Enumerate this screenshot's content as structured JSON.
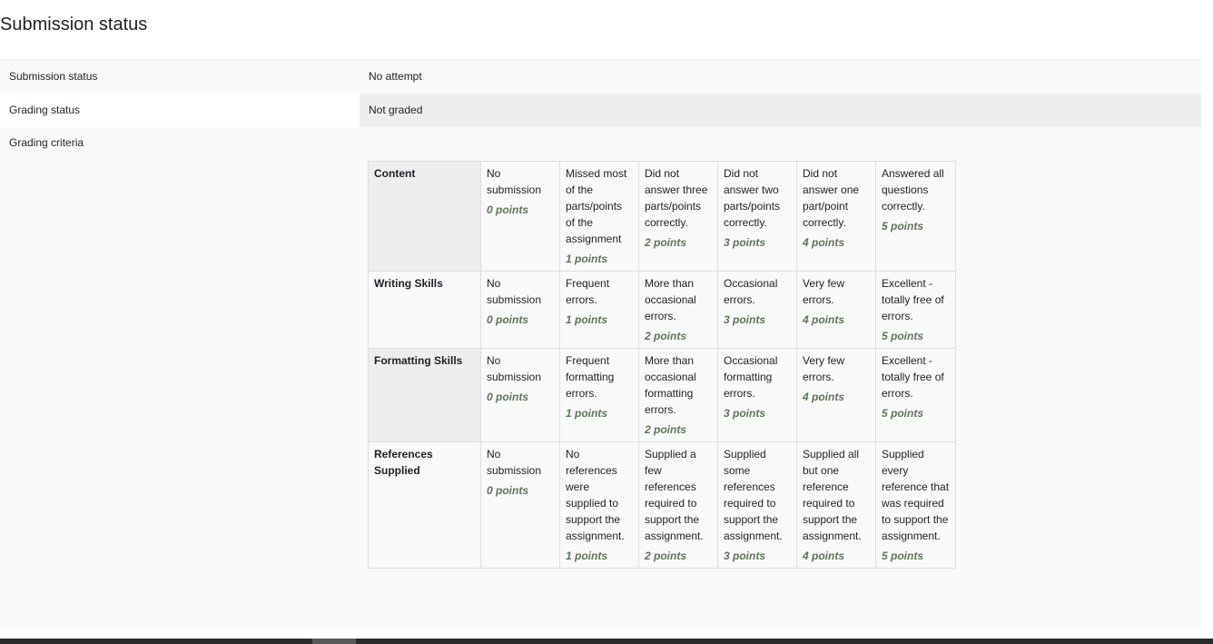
{
  "page": {
    "title": "Submission status"
  },
  "status": {
    "submission_label": "Submission status",
    "submission_value": "No attempt",
    "grading_label": "Grading status",
    "grading_value": "Not graded",
    "criteria_label": "Grading criteria"
  },
  "rubric": {
    "criteria": [
      {
        "name": "Content",
        "levels": [
          {
            "text": "No submission",
            "points": "0 points"
          },
          {
            "text": "Missed most of the parts/points of the assignment",
            "points": "1 points"
          },
          {
            "text": "Did not answer three parts/points correctly.",
            "points": "2 points"
          },
          {
            "text": "Did not answer two parts/points correctly.",
            "points": "3 points"
          },
          {
            "text": "Did not answer one part/point correctly.",
            "points": "4 points"
          },
          {
            "text": "Answered all questions correctly.",
            "points": "5 points"
          }
        ]
      },
      {
        "name": "Writing Skills",
        "levels": [
          {
            "text": "No submission",
            "points": "0 points"
          },
          {
            "text": "Frequent errors.",
            "points": "1 points"
          },
          {
            "text": "More than occasional errors.",
            "points": "2 points"
          },
          {
            "text": "Occasional errors.",
            "points": "3 points"
          },
          {
            "text": "Very few errors.",
            "points": "4 points"
          },
          {
            "text": "Excellent - totally free of errors.",
            "points": "5 points"
          }
        ]
      },
      {
        "name": "Formatting Skills",
        "levels": [
          {
            "text": "No submission",
            "points": "0 points"
          },
          {
            "text": "Frequent formatting errors.",
            "points": "1 points"
          },
          {
            "text": "More than occasional formatting errors.",
            "points": "2 points"
          },
          {
            "text": "Occasional formatting errors.",
            "points": "3 points"
          },
          {
            "text": "Very few errors.",
            "points": "4 points"
          },
          {
            "text": "Excellent - totally free of errors.",
            "points": "5 points"
          }
        ]
      },
      {
        "name": "References Supplied",
        "levels": [
          {
            "text": "No submission",
            "points": "0 points"
          },
          {
            "text": "No references were supplied to support the assignment.",
            "points": "1 points"
          },
          {
            "text": "Supplied a few references required to support the assignment.",
            "points": "2 points"
          },
          {
            "text": "Supplied some references required to support the assignment.",
            "points": "3 points"
          },
          {
            "text": "Supplied all but one reference required to support the assignment.",
            "points": "4 points"
          },
          {
            "text": "Supplied every reference that was required to support the assignment.",
            "points": "5 points"
          }
        ]
      }
    ]
  }
}
